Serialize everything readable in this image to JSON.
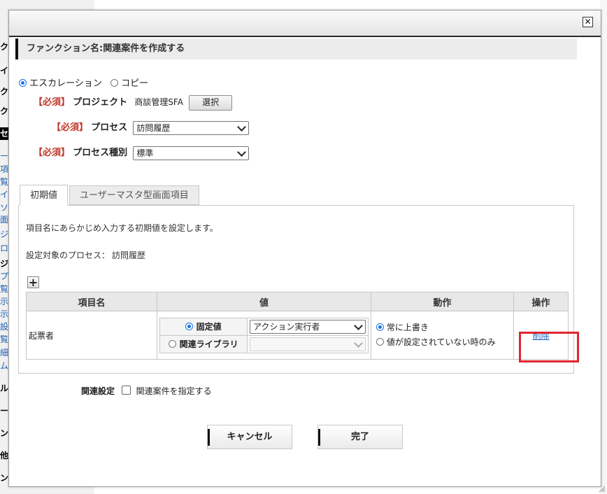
{
  "background": {
    "left_fragments": [
      {
        "text": "ク",
        "style": "bold"
      },
      {
        "text": "イブ",
        "style": "bold"
      },
      {
        "text": "ク",
        "style": "bold"
      },
      {
        "text": "ク",
        "style": "bold"
      },
      {
        "text": "セ",
        "style": "dark"
      },
      {
        "text": "ー",
        "style": "link"
      },
      {
        "text": "項",
        "style": "link"
      },
      {
        "text": "覧",
        "style": "link"
      },
      {
        "text": "イ",
        "style": "link"
      },
      {
        "text": "ソ",
        "style": "link"
      },
      {
        "text": "面",
        "style": "link"
      },
      {
        "text": "ジ",
        "style": "link"
      },
      {
        "text": "ロ",
        "style": "link"
      },
      {
        "text": "ジ",
        "style": "bold"
      },
      {
        "text": "プ",
        "style": "link"
      },
      {
        "text": "覧",
        "style": "link"
      },
      {
        "text": "示",
        "style": "link"
      },
      {
        "text": "示",
        "style": "link"
      },
      {
        "text": "設",
        "style": "link"
      },
      {
        "text": "覧",
        "style": "link"
      },
      {
        "text": "細",
        "style": "link"
      },
      {
        "text": "ム",
        "style": "link"
      },
      {
        "text": "ル",
        "style": "bold"
      },
      {
        "text": "ー",
        "style": "bold"
      },
      {
        "text": "ン",
        "style": "bold"
      },
      {
        "text": "他",
        "style": "bold"
      },
      {
        "text": "ン",
        "style": "bold"
      }
    ]
  },
  "dialog": {
    "close_icon": "close-icon",
    "header": "ファンクション名:関連案件を作成する",
    "mode_options": [
      {
        "label": "エスカレーション",
        "selected": true
      },
      {
        "label": "コピー",
        "selected": false
      }
    ],
    "required_tag": "【必須】",
    "project": {
      "label": "プロジェクト",
      "value": "商談管理SFA",
      "button": "選択"
    },
    "process": {
      "label": "プロセス",
      "selected": "訪問履歴"
    },
    "process_type": {
      "label": "プロセス種別",
      "selected": "標準"
    },
    "tabs": [
      {
        "label": "初期値",
        "active": true
      },
      {
        "label": "ユーザーマスタ型画面項目",
        "active": false
      }
    ],
    "panel": {
      "description": "項目名にあらかじめ入力する初期値を設定します。",
      "target_label": "設定対象のプロセス：",
      "target_value": "訪問履歴",
      "add_button": "+",
      "columns": [
        "項目名",
        "値",
        "動作",
        "操作"
      ],
      "rows": [
        {
          "item_name": "起票者",
          "value_options": [
            {
              "label": "固定値",
              "selected": true,
              "select_value": "アクション実行者",
              "enabled": true
            },
            {
              "label": "関連ライブラリ",
              "selected": false,
              "select_value": "",
              "enabled": false
            }
          ],
          "action_options": [
            {
              "label": "常に上書き",
              "selected": true
            },
            {
              "label": "値が設定されていない時のみ",
              "selected": false
            }
          ],
          "operation": "削除"
        }
      ]
    },
    "related": {
      "label": "関連設定",
      "checkbox_label": "関連案件を指定する",
      "checked": false
    },
    "footer": {
      "cancel": "キャンセル",
      "done": "完了"
    },
    "highlight_color": "#e0262f",
    "link_color": "#1a66c2",
    "required_color": "#c0392b"
  }
}
